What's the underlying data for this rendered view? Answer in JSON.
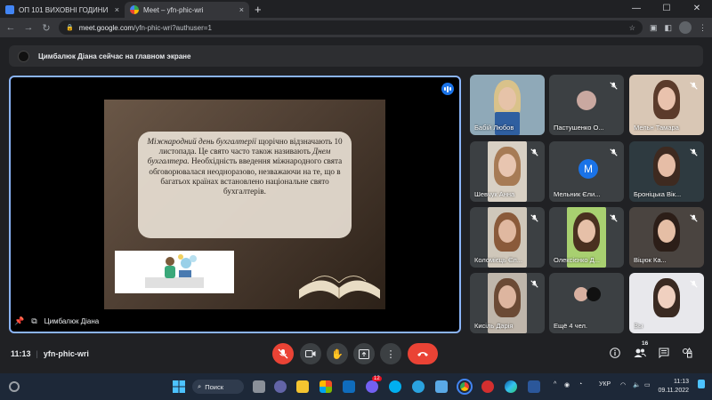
{
  "browser": {
    "tabs": [
      {
        "title": "ОП 101 ВИХОВНІ ГОДИНИ",
        "close": "×",
        "active": false
      },
      {
        "title": "Meet – yfn-phic-wri",
        "close": "×",
        "active": true
      }
    ],
    "new_tab": "+",
    "window_controls": {
      "minimize": "—",
      "maximize": "☐",
      "close": "✕"
    },
    "url_host": "meet.google.com",
    "url_path": "/yfn-phic-wri?authuser=1"
  },
  "presentation_banner": "Цимбалюк Діана сейчас на главном экране",
  "main": {
    "presenter_name": "Цимбалюк Діана",
    "slide": {
      "italic_1": "Міжнародний день бухгалтерії",
      "text_1": " щорічно відзначають 10 листопада. Це свято часто також називають ",
      "italic_2": "Днем бухгалтера.",
      "text_2": " Необхідність введення міжнародного свята обговорювалася неодноразово, незважаючи на те, що в багатьох країнах встановлено національне свято бухгалтерів."
    }
  },
  "participants": [
    {
      "name": "Бабій Любов",
      "muted": false
    },
    {
      "name": "Пастушенко О...",
      "muted": true
    },
    {
      "name": "Мельн Тамара",
      "muted": true
    },
    {
      "name": "Шевчук Анна",
      "muted": true
    },
    {
      "name": "Мельник Єли...",
      "muted": true,
      "letter": "M"
    },
    {
      "name": "Броніцька Вік...",
      "muted": true
    },
    {
      "name": "Коломієць Єл...",
      "muted": true
    },
    {
      "name": "Олексієнко Д...",
      "muted": true
    },
    {
      "name": "Віцюк Ка...",
      "muted": true
    },
    {
      "name": "Кисіль Дарія",
      "muted": true
    },
    {
      "name": "Ещё 4 чел.",
      "muted": false
    },
    {
      "name": "Вы",
      "muted": true
    }
  ],
  "controls": {
    "time": "11:13",
    "separator": "|",
    "meeting_code": "yfn-phic-wri",
    "people_count": "16"
  },
  "taskbar": {
    "search_label": "Поиск",
    "language": "УКР",
    "time": "11:13",
    "date": "09.11.2022",
    "telegram_badge": "12"
  },
  "colors": {
    "accent_blue": "#8ab4f8",
    "end_red": "#ea4335",
    "meet_bg": "#202124"
  }
}
